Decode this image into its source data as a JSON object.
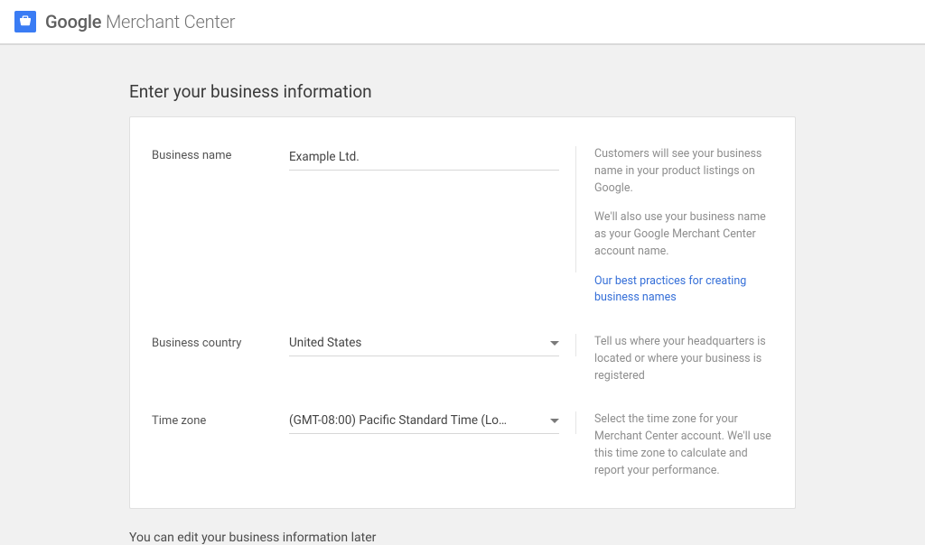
{
  "header": {
    "brand_bold": "Google",
    "brand_light": " Merchant Center"
  },
  "page": {
    "title": "Enter your business information",
    "note": "You can edit your business information later"
  },
  "form": {
    "business_name": {
      "label": "Business name",
      "value": "Example Ltd.",
      "help_1": "Customers will see your business name in your product listings on Google.",
      "help_2": "We'll also use your business name as your Google Merchant Center account name.",
      "help_link": "Our best practices for creating business names"
    },
    "business_country": {
      "label": "Business country",
      "value": "United States",
      "help": "Tell us where your headquarters is located or where your business is registered"
    },
    "time_zone": {
      "label": "Time zone",
      "value": "(GMT-08:00) Pacific Standard Time (Lo…",
      "help": "Select the time zone for your Merchant Center account. We'll use this time zone to calculate and report your performance."
    }
  }
}
